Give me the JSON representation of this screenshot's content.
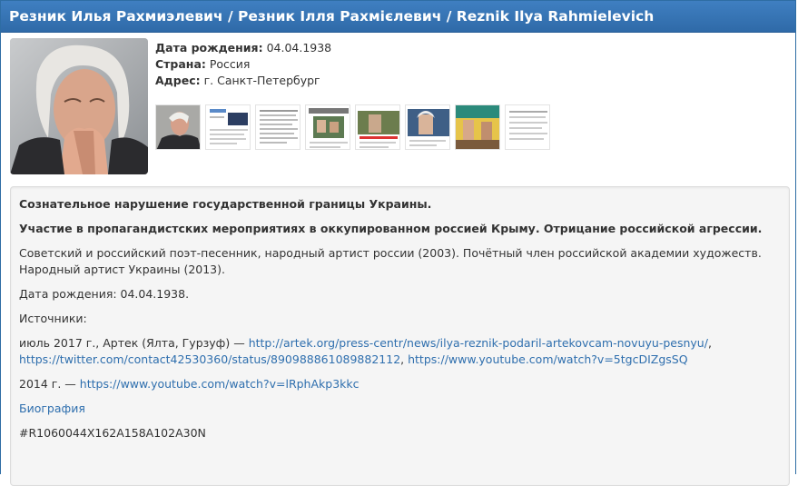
{
  "header": {
    "title": "Резник Илья Рахмиэлевич / Резник Ілля Рахмієлевич / Reznik Ilya Rahmielevich"
  },
  "info": {
    "birth_label": "Дата рождения:",
    "birth_value": "04.04.1938",
    "country_label": "Страна:",
    "country_value": "Россия",
    "address_label": "Адрес:",
    "address_value": "г. Санкт-Петербург"
  },
  "thumbnails_count": 8,
  "description": {
    "charge_1": "Сознательное нарушение государственной границы Украины.",
    "charge_2": "Участие в пропагандистских мероприятиях в оккупированном россией Крыму. Отрицание российской агрессии.",
    "bio": "Советский и российский поэт-песенник, народный артист россии (2003). Почётный член российской академии художеств. Народный артист Украины (2013).",
    "birth_line": "Дата рождения: 04.04.1938.",
    "sources_label": "Источники:",
    "source_1_prefix": "июль 2017 г., Артек (Ялта, Гурзуф) — ",
    "source_1_link_1": "http://artek.org/press-centr/news/ilya-reznik-podaril-artekovcam-novuyu-pesnyu/",
    "source_1_sep_1": ",",
    "source_1_link_2": "https://twitter.com/contact42530360/status/890988861089882112",
    "source_1_sep_2": ", ",
    "source_1_link_3": "https://www.youtube.com/watch?v=5tgcDIZgsSQ",
    "source_2_prefix": "2014 г. — ",
    "source_2_link": "https://www.youtube.com/watch?v=lRphAkp3kkc",
    "bio_link": "Биография",
    "record_id": "#R1060044X162A158A102A30N"
  }
}
